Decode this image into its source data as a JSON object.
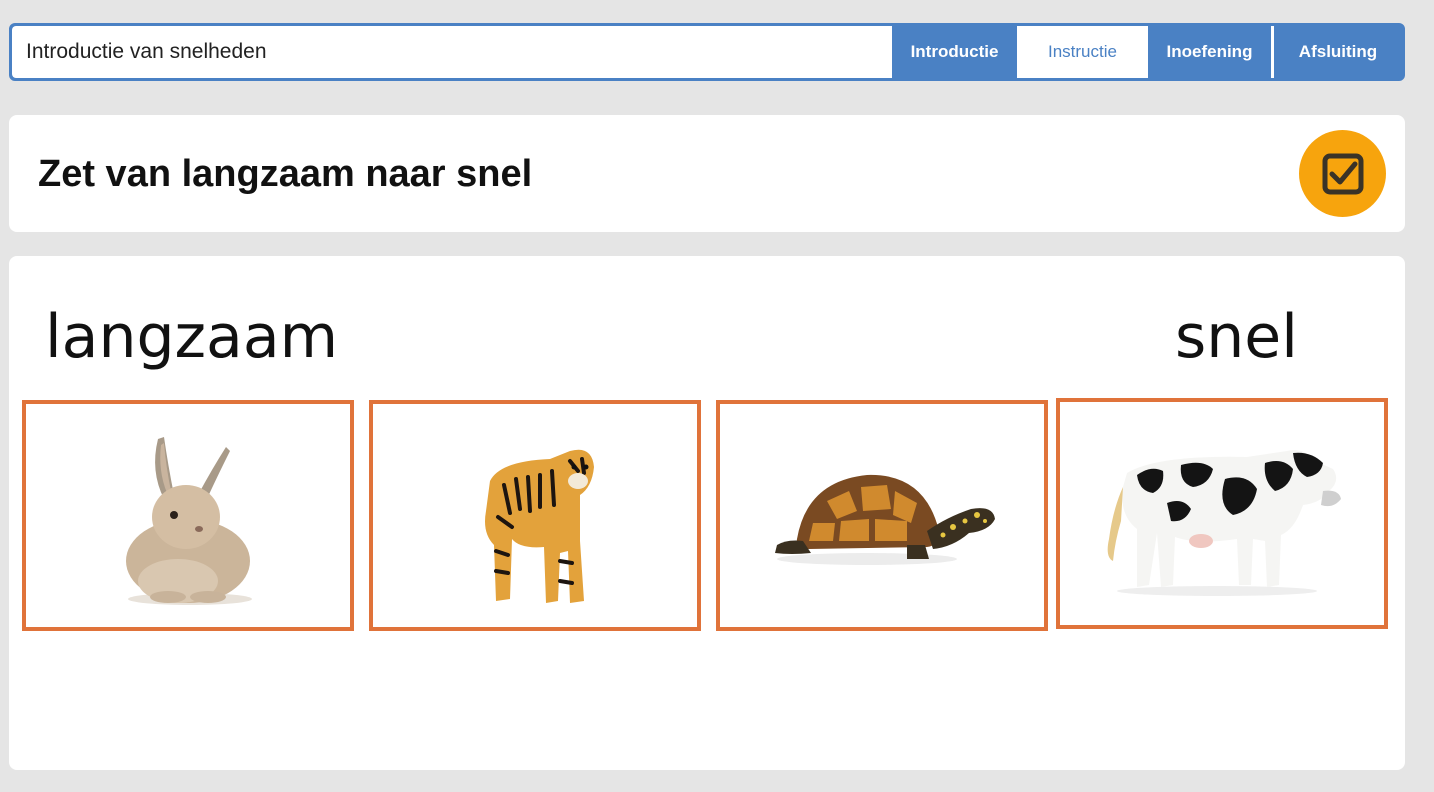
{
  "header": {
    "lesson_title": "Introductie van snelheden",
    "tabs": [
      {
        "label": "Introductie",
        "active": false
      },
      {
        "label": "Instructie",
        "active": true
      },
      {
        "label": "Inoefening",
        "active": false
      },
      {
        "label": "Afsluiting",
        "active": false
      }
    ]
  },
  "question": {
    "title": "Zet van langzaam naar snel",
    "check_icon": "checkbox-check-icon"
  },
  "scale": {
    "slow_label": "langzaam",
    "fast_label": "snel"
  },
  "cards": [
    {
      "animal": "rabbit"
    },
    {
      "animal": "tiger"
    },
    {
      "animal": "turtle"
    },
    {
      "animal": "cow"
    }
  ],
  "colors": {
    "accent_blue": "#4a81c4",
    "check_orange": "#f7a40d",
    "card_border": "#e0733a"
  }
}
